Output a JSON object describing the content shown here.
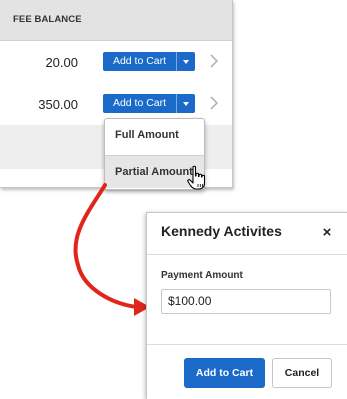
{
  "fee_table": {
    "header": "FEE BALANCE",
    "rows": [
      {
        "balance": "20.00",
        "button_label": "Add to Cart"
      },
      {
        "balance": "350.00",
        "button_label": "Add to Cart"
      }
    ],
    "dropdown": {
      "items": [
        "Full Amount",
        "Partial Amount"
      ]
    }
  },
  "modal": {
    "title": "Kennedy Activites",
    "close_glyph": "×",
    "payment_label": "Payment Amount",
    "payment_value": "$100.00",
    "add_label": "Add to Cart",
    "cancel_label": "Cancel"
  },
  "colors": {
    "accent_blue": "#1b6ac9",
    "arrow_red": "#e0261b",
    "header_gray": "#e3e3e3"
  },
  "icons": [
    "caret-down-icon",
    "chevron-right-icon",
    "hand-cursor-icon",
    "close-icon",
    "red-arrow-icon"
  ]
}
